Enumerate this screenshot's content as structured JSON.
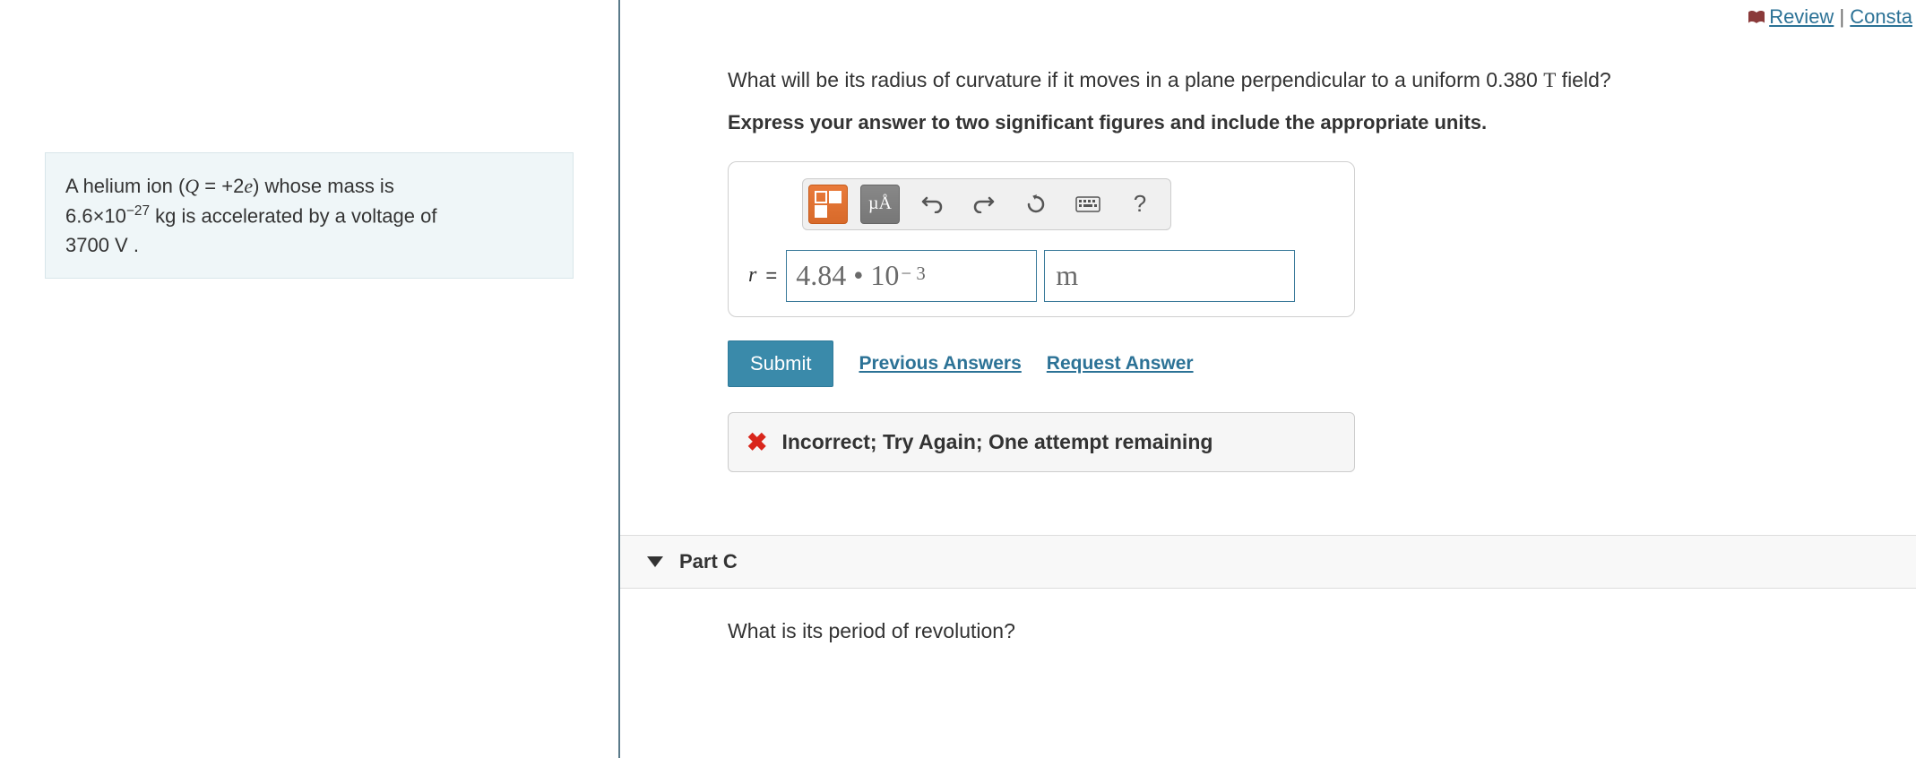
{
  "topLinks": {
    "review": "Review",
    "constants": "Consta"
  },
  "problem": {
    "line1_pre": "A helium ion (",
    "line1_Q": "Q",
    "line1_mid": " = +2",
    "line1_e": "e",
    "line1_post": ") whose mass is",
    "line2_val": "6.6×10",
    "line2_exp": "−27",
    "line2_unit": " kg",
    "line2_post": " is accelerated by a voltage of",
    "line3_val": "3700  V .",
    "line3_unit": ""
  },
  "question": {
    "text_pre": "What will be its radius of curvature if it moves in a plane perpendicular to a uniform 0.380  ",
    "text_T": "T",
    "text_post": " field?",
    "instruction": "Express your answer to two significant figures and include the appropriate units."
  },
  "toolbar": {
    "units_label": "µÅ",
    "help": "?"
  },
  "answer": {
    "var": "r",
    "eq": "=",
    "value_main": "4.84 • 10",
    "value_exp": "− 3",
    "unit": "m"
  },
  "actions": {
    "submit": "Submit",
    "previous": "Previous Answers",
    "request": "Request Answer"
  },
  "feedback": {
    "text": "Incorrect; Try Again; One attempt remaining"
  },
  "partC": {
    "title": "Part C",
    "question": "What is its period of revolution?"
  }
}
